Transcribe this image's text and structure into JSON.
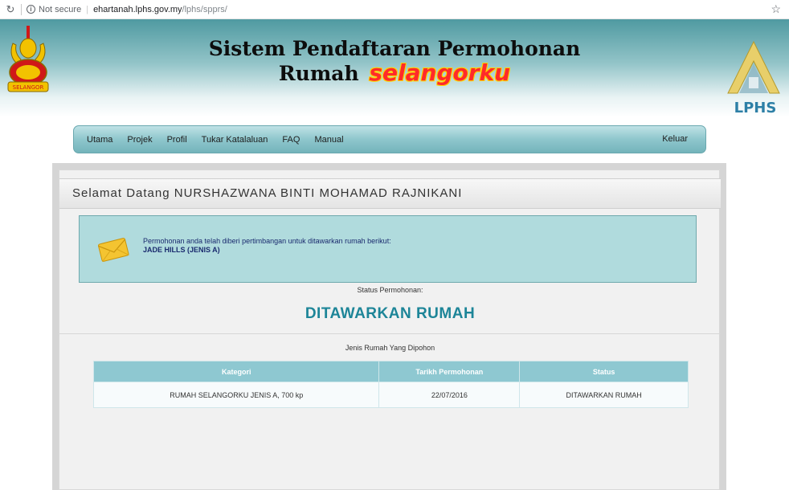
{
  "browser": {
    "reload_icon": "reload-icon",
    "security_label": "Not secure",
    "url_host": "ehartanah.lphs.gov.my",
    "url_path": "/lphs/spprs/"
  },
  "header": {
    "title_line1": "Sistem Pendaftaran Permohonan",
    "title_line2": "Rumah",
    "brand": "selangorku",
    "left_logo_text": "SELANGOR",
    "right_logo_text": "LPHS"
  },
  "nav": {
    "items": [
      {
        "label": "Utama"
      },
      {
        "label": "Projek"
      },
      {
        "label": "Profil"
      },
      {
        "label": "Tukar Katalaluan"
      },
      {
        "label": "FAQ"
      },
      {
        "label": "Manual"
      }
    ],
    "logout": "Keluar"
  },
  "main": {
    "welcome": "Selamat Datang NURSHAZWANA BINTI MOHAMAD RAJNIKANI",
    "notice": {
      "message": "Permohonan anda telah diberi pertimbangan untuk ditawarkan rumah berikut:",
      "house": "JADE HILLS (JENIS A)"
    },
    "status_label": "Status Permohonan:",
    "status_value": "DITAWARKAN RUMAH",
    "table_caption": "Jenis Rumah Yang Dipohon",
    "table": {
      "headers": [
        "Kategori",
        "Tarikh Permohonan",
        "Status"
      ],
      "rows": [
        [
          "RUMAH SELANGORKU JENIS A, 700 kp",
          "22/07/2016",
          "DITAWARKAN RUMAH"
        ]
      ]
    }
  },
  "colors": {
    "accent": "#1d8598",
    "nav": "#8ec6cc",
    "table_header": "#8ec8d1",
    "notice_bg": "#b0dbdd",
    "brand": "#ff2a2a"
  }
}
